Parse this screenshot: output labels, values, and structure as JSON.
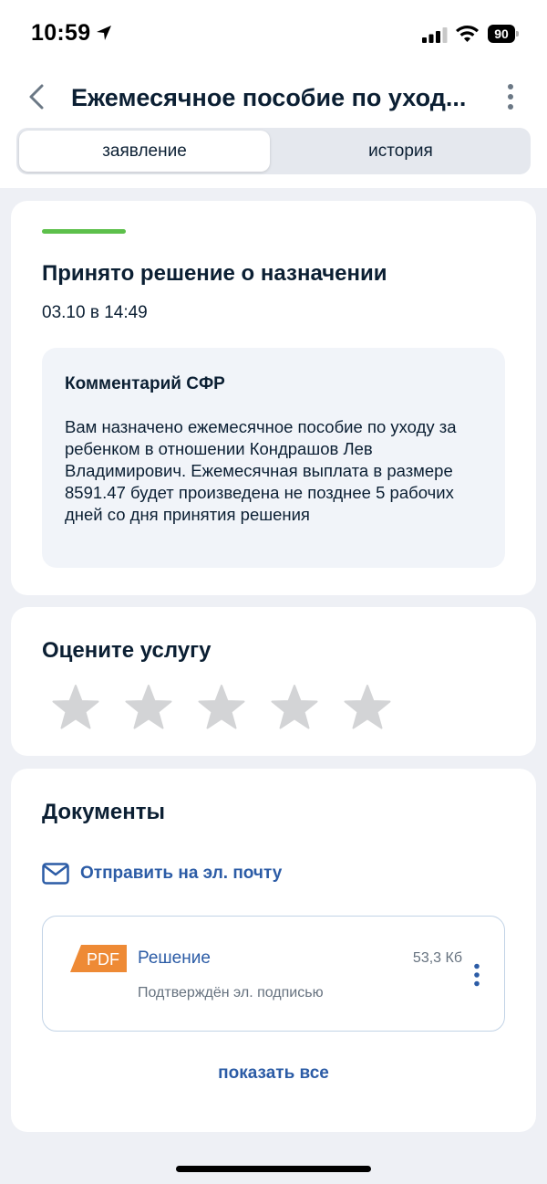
{
  "status_bar": {
    "time": "10:59",
    "battery": "90"
  },
  "header": {
    "title": "Ежемесячное пособие по уход...",
    "tabs": [
      {
        "label": "заявление",
        "active": true
      },
      {
        "label": "история",
        "active": false
      }
    ]
  },
  "status_card": {
    "title": "Принято решение о назначении",
    "date": "03.10 в 14:49",
    "accent_color": "#5dc04b",
    "comment": {
      "title": "Комментарий СФР",
      "text": "Вам назначено ежемесячное пособие по уходу за ребенком в отношении Кондрашов Лев Владимирович. Ежемесячная выплата в размере 8591.47 будет произведена не позднее 5 рабочих дней со дня принятия решения"
    }
  },
  "rating_card": {
    "title": "Оцените услугу",
    "stars": 5,
    "rating": 0
  },
  "documents_card": {
    "title": "Документы",
    "email_link": "Отправить на эл. почту",
    "items": [
      {
        "type": "PDF",
        "name": "Решение",
        "size": "53,3 Кб",
        "note": "Подтверждён эл. подписью"
      }
    ],
    "show_all": "показать все"
  },
  "colors": {
    "link": "#2c5ca6",
    "pdf": "#ee8a35",
    "star_empty": "#d3d4d6"
  }
}
